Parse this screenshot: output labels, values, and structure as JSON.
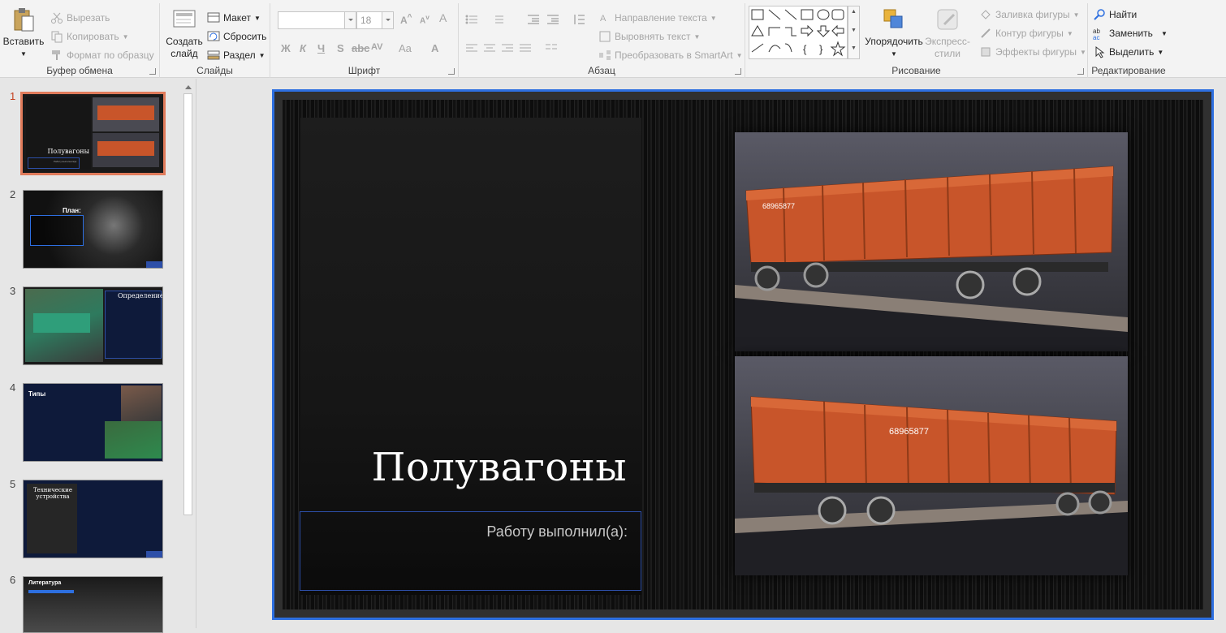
{
  "ribbon": {
    "clipboard": {
      "paste": "Вставить",
      "cut": "Вырезать",
      "copy": "Копировать",
      "format_painter": "Формат по образцу",
      "label": "Буфер обмена"
    },
    "slides": {
      "new_slide_line1": "Создать",
      "new_slide_line2": "слайд",
      "layout": "Макет",
      "reset": "Сбросить",
      "section": "Раздел",
      "label": "Слайды"
    },
    "font": {
      "font_name": "",
      "font_size": "18",
      "bold": "Ж",
      "italic": "К",
      "underline": "Ч",
      "strike": "S",
      "spacing": "AV",
      "case": "Aa",
      "label": "Шрифт"
    },
    "paragraph": {
      "text_direction": "Направление текста",
      "align_text": "Выровнять текст",
      "smartart": "Преобразовать в SmartArt",
      "label": "Абзац"
    },
    "drawing": {
      "arrange": "Упорядочить",
      "quick_styles_line1": "Экспресс-",
      "quick_styles_line2": "стили",
      "shape_fill": "Заливка фигуры",
      "shape_outline": "Контур фигуры",
      "shape_effects": "Эффекты фигуры",
      "label": "Рисование"
    },
    "editing": {
      "find": "Найти",
      "replace": "Заменить",
      "select": "Выделить",
      "label": "Редактирование"
    }
  },
  "thumbnails": [
    {
      "num": "1",
      "title": "Полувагоны",
      "sub": "Работу выполнил(а):"
    },
    {
      "num": "2",
      "title": "План:"
    },
    {
      "num": "3",
      "title": "Определение"
    },
    {
      "num": "4",
      "title": "Типы"
    },
    {
      "num": "5",
      "title": "Технические устройства"
    },
    {
      "num": "6",
      "title": "Литература"
    }
  ],
  "slide": {
    "title": "Полувагоны",
    "subtitle": "Работу выполнил(а):",
    "wagon_number": "68965877"
  },
  "colors": {
    "selection_border": "#2d6fe0",
    "active_thumb": "#e07b5b",
    "wagon_orange": "#c8552a"
  }
}
